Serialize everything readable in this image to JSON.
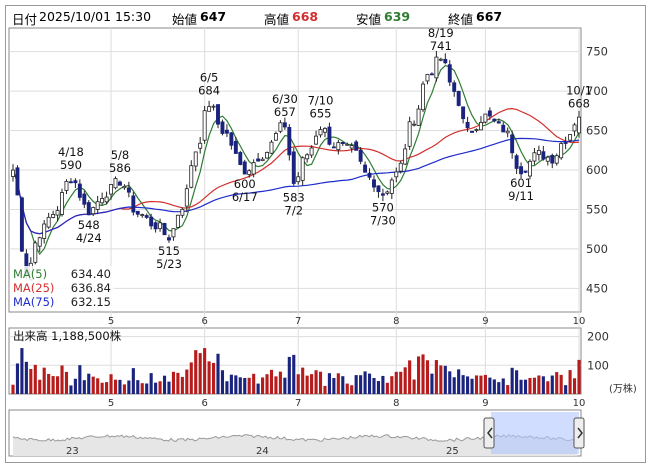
{
  "header": {
    "date_label": "日付",
    "date_value": "2025/10/01 15:30",
    "open_label": "始値",
    "open_value": "647",
    "high_label": "高値",
    "high_value": "668",
    "low_label": "安値",
    "low_value": "639",
    "close_label": "終値",
    "close_value": "667"
  },
  "colors": {
    "up": "#ffffff",
    "down": "#1a237e",
    "ma5": "#2e7d32",
    "ma25": "#d32f2f",
    "ma75": "#1e2ccc",
    "volume": "#b71c1c",
    "volume_down": "#1a237e",
    "high_value": "#d32f2f",
    "low_value": "#2e7d32"
  },
  "chart_data": [
    {
      "type": "candlestick",
      "ylim": [
        420,
        780
      ],
      "yticks": [
        450,
        500,
        550,
        600,
        650,
        700,
        750
      ],
      "month_ticks": [
        {
          "label": "5",
          "index": 22
        },
        {
          "label": "6",
          "index": 43
        },
        {
          "label": "7",
          "index": 64
        },
        {
          "label": "8",
          "index": 86
        },
        {
          "label": "9",
          "index": 106
        },
        {
          "label": "10",
          "index": 127
        }
      ],
      "ma_legend": [
        {
          "name": "MA(5)",
          "value": "634.40"
        },
        {
          "name": "MA(25)",
          "value": "636.84"
        },
        {
          "name": "MA(75)",
          "value": "632.15"
        }
      ],
      "annotations": [
        {
          "date": "4/18",
          "value": "590",
          "index": 13,
          "pos": "above"
        },
        {
          "date": "4/24",
          "value": "548",
          "index": 17,
          "pos": "below"
        },
        {
          "date": "5/8",
          "value": "586",
          "index": 24,
          "pos": "above"
        },
        {
          "date": "5/23",
          "value": "515",
          "index": 35,
          "pos": "below"
        },
        {
          "date": "6/5",
          "value": "684",
          "index": 44,
          "pos": "above"
        },
        {
          "date": "6/17",
          "value": "600",
          "index": 52,
          "pos": "below"
        },
        {
          "date": "6/30",
          "value": "657",
          "index": 61,
          "pos": "above"
        },
        {
          "date": "7/2",
          "value": "583",
          "index": 63,
          "pos": "below"
        },
        {
          "date": "7/10",
          "value": "655",
          "index": 69,
          "pos": "above"
        },
        {
          "date": "7/30",
          "value": "570",
          "index": 83,
          "pos": "below"
        },
        {
          "date": "8/19",
          "value": "741",
          "index": 96,
          "pos": "above"
        },
        {
          "date": "9/11",
          "value": "601",
          "index": 114,
          "pos": "below"
        },
        {
          "date": "10/1",
          "value": "668",
          "index": 127,
          "pos": "above"
        }
      ]
    },
    {
      "type": "bar",
      "title": "出来高",
      "latest_volume": "1,188,500株",
      "unit": "(万株)",
      "ylim": [
        0,
        230
      ],
      "yticks": [
        100,
        200
      ]
    },
    {
      "type": "area",
      "title": "overview",
      "labels": [
        "23",
        "24",
        "25"
      ]
    }
  ]
}
